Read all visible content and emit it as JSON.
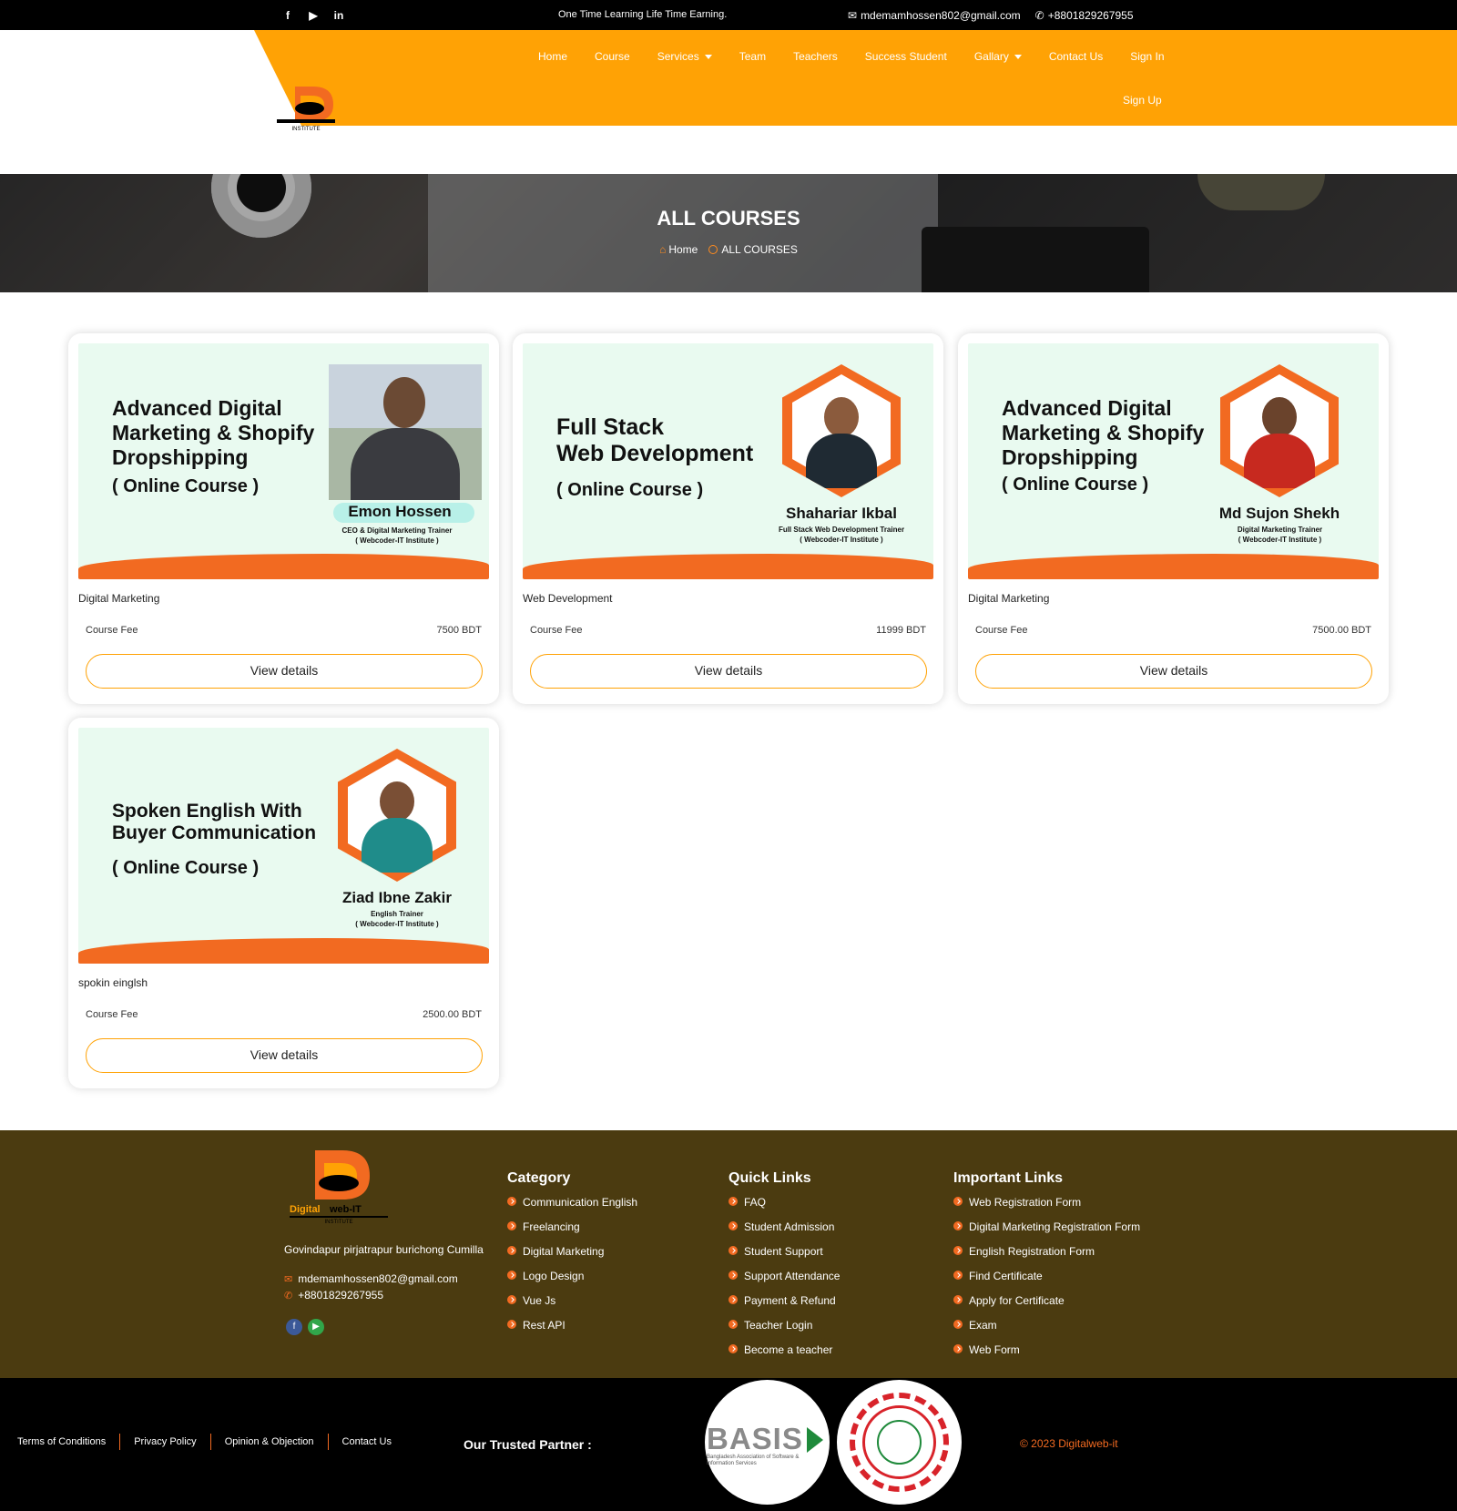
{
  "topbar": {
    "tagline": "One Time Learning Life Time Earning.",
    "email": "mdemamhossen802@gmail.com",
    "phone": "+8801829267955",
    "social": [
      "facebook-icon",
      "youtube-icon",
      "linkedin-icon"
    ]
  },
  "brand": {
    "logo_text_1": "Digital",
    "logo_text_2": "web-IT",
    "logo_text_3": "INSTITUTE"
  },
  "nav": {
    "items": [
      {
        "label": "Home"
      },
      {
        "label": "Course"
      },
      {
        "label": "Services"
      },
      {
        "label": "Team"
      },
      {
        "label": "Teachers"
      },
      {
        "label": "Success Student"
      },
      {
        "label": "Gallary"
      },
      {
        "label": "Contact Us"
      },
      {
        "label": "Sign In"
      }
    ],
    "signup": "Sign Up"
  },
  "hero": {
    "title": "ALL COURSES",
    "crumb_home": "Home",
    "crumb_current": "ALL COURSES"
  },
  "courses": [
    {
      "thumb_title": [
        "Advanced Digital",
        "Marketing & Shopify",
        "Dropshipping"
      ],
      "thumb_sub": "( Online Course )",
      "trainer": "Emon Hossen",
      "role": "CEO & Digital Marketing Trainer",
      "org": "( Webcoder-IT Institute )",
      "category": "Digital Marketing",
      "fee_label": "Course Fee",
      "fee": "7500 BDT",
      "button": "View details"
    },
    {
      "thumb_title": [
        "Full Stack",
        "Web Development"
      ],
      "thumb_sub": "( Online Course )",
      "trainer": "Shahariar Ikbal",
      "role": "Full Stack Web Development Trainer",
      "org": "( Webcoder-IT Institute )",
      "category": "Web Development",
      "fee_label": "Course Fee",
      "fee": "11999 BDT",
      "button": "View details"
    },
    {
      "thumb_title": [
        "Advanced Digital",
        "Marketing & Shopify",
        "Dropshipping"
      ],
      "thumb_sub": "( Online Course )",
      "trainer": "Md Sujon Shekh",
      "role": "Digital Marketing Trainer",
      "org": "( Webcoder-IT Institute )",
      "category": "Digital Marketing",
      "fee_label": "Course Fee",
      "fee": "7500.00 BDT",
      "button": "View details"
    },
    {
      "thumb_title": [
        "Spoken English With",
        "Buyer Communication"
      ],
      "thumb_sub": "( Online Course )",
      "trainer": "Ziad Ibne Zakir",
      "role": "English Trainer",
      "org": "( Webcoder-IT Institute )",
      "category": "spokin einglsh",
      "fee_label": "Course Fee",
      "fee": "2500.00 BDT",
      "button": "View details"
    }
  ],
  "footer": {
    "address": "Govindapur pirjatrapur burichong Cumilla",
    "email": "mdemamhossen802@gmail.com",
    "phone": "+8801829267955",
    "category": {
      "title": "Category",
      "items": [
        "Communication English",
        "Freelancing",
        "Digital Marketing",
        "Logo Design",
        "Vue Js",
        "Rest API"
      ]
    },
    "quick": {
      "title": "Quick Links",
      "items": [
        "FAQ",
        "Student Admission",
        "Student Support",
        "Support Attendance",
        "Payment & Refund",
        "Teacher Login",
        "Become a teacher"
      ]
    },
    "important": {
      "title": "Important Links",
      "items": [
        "Web Registration Form",
        "Digital Marketing Registration Form",
        "English Registration Form",
        "Find Certificate",
        "Apply for Certificate",
        "Exam",
        "Web Form"
      ]
    }
  },
  "bottom": {
    "links": [
      "Terms of Conditions",
      "Privacy Policy",
      "Opinion & Objection",
      "Contact Us"
    ],
    "partner": "Our Trusted Partner :",
    "basis": "BASIS",
    "basis_sub": "Bangladesh Association of Software & Information Services",
    "copyright": "© 2023 Digitalweb-it"
  },
  "colors": {
    "accent": "#ffa205",
    "orange": "#f26a21",
    "footer_bg": "#4b3b10"
  }
}
